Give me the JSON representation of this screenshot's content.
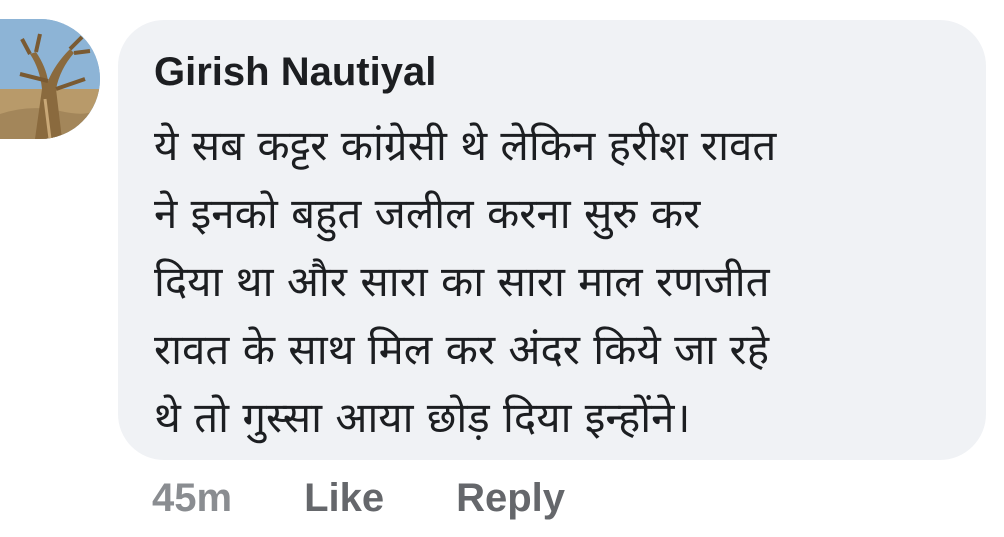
{
  "comment": {
    "author": "Girish Nautiyal",
    "text": "ये सब कट्टर कांग्रेसी थे लेकिन हरीश रावत\nने इनको बहुत जलील करना सुरु कर\nदिया था और सारा का सारा माल रणजीत\nरावत के साथ मिल कर अंदर किये जा रहे\nथे तो गुस्सा आया छोड़ दिया इन्होंने।",
    "timestamp": "45m",
    "like_label": "Like",
    "reply_label": "Reply"
  },
  "colors": {
    "bubble_background": "#f0f2f5",
    "author_text": "#1c1e21",
    "meta_text": "#65676b"
  }
}
